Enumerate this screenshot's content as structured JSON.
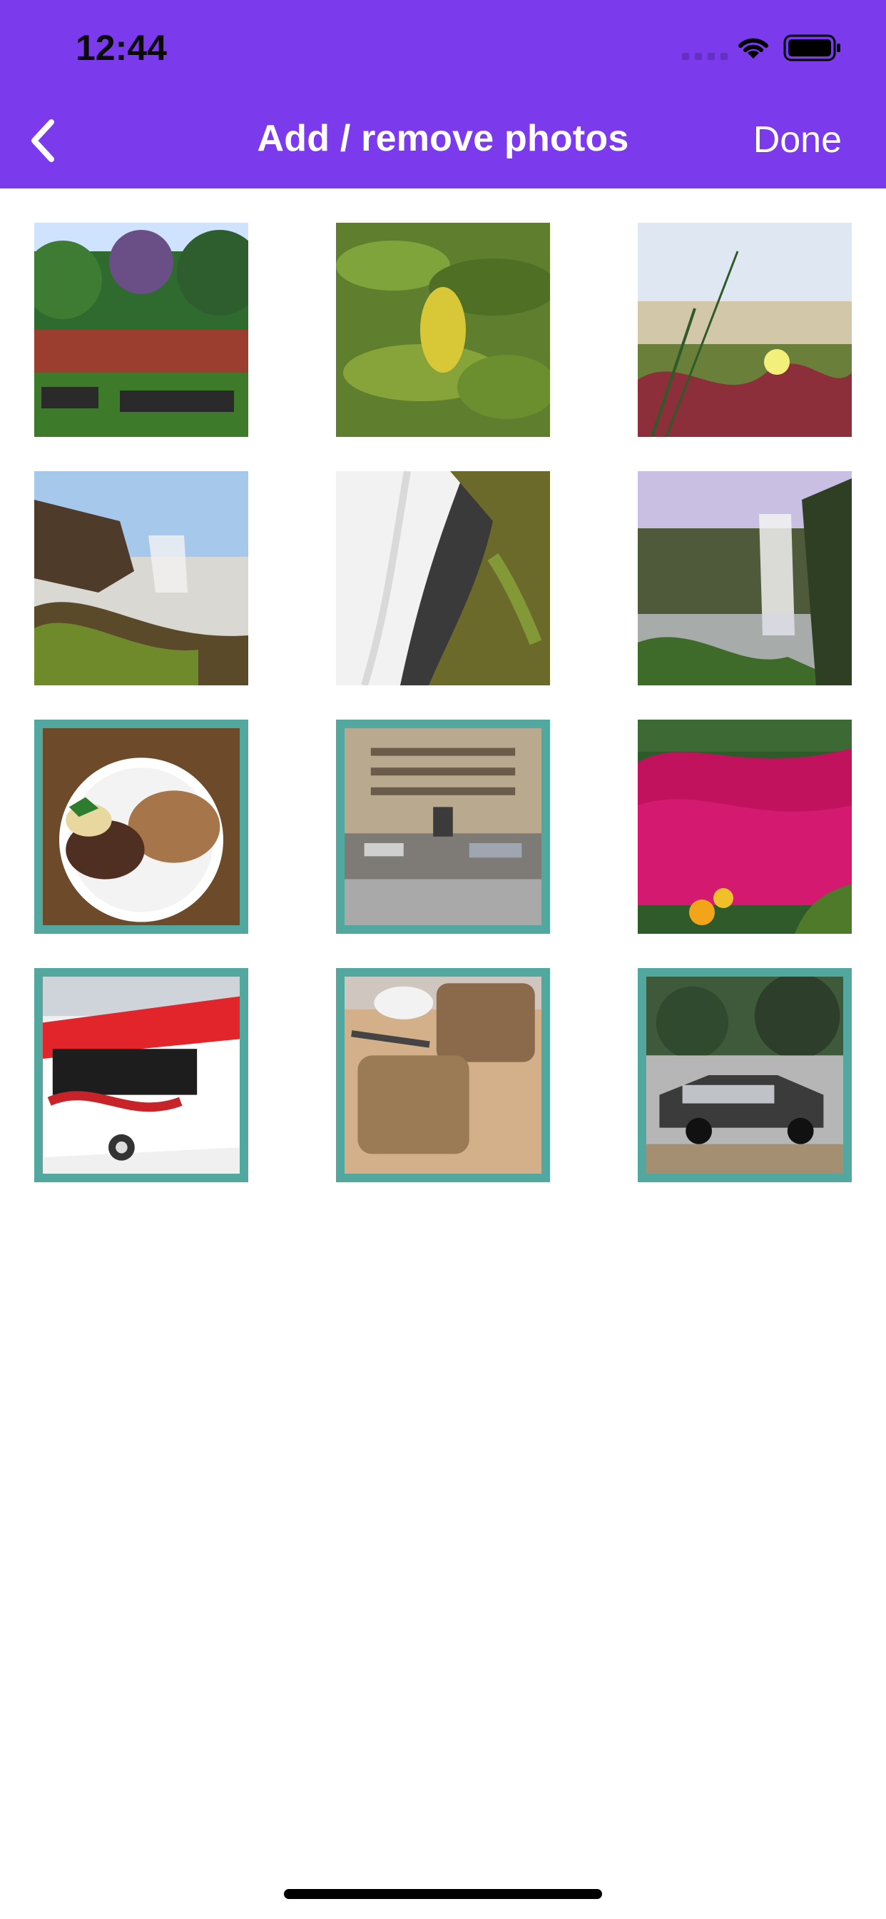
{
  "status_bar": {
    "time": "12:44"
  },
  "nav": {
    "title": "Add / remove photos",
    "done_label": "Done"
  },
  "colors": {
    "header": "#7c3aed",
    "selected_border": "#52a89f"
  },
  "photos": [
    {
      "subject": "garden with benches",
      "selected": false
    },
    {
      "subject": "green leaves",
      "selected": false
    },
    {
      "subject": "flower on dunes",
      "selected": false
    },
    {
      "subject": "waterfall by rocks",
      "selected": false
    },
    {
      "subject": "waterfall long exposure",
      "selected": false
    },
    {
      "subject": "misty waterfall",
      "selected": false
    },
    {
      "subject": "plate of food",
      "selected": true
    },
    {
      "subject": "building facade",
      "selected": true
    },
    {
      "subject": "pink flowers",
      "selected": false
    },
    {
      "subject": "red bus",
      "selected": true
    },
    {
      "subject": "bread loaf slices",
      "selected": true
    },
    {
      "subject": "vintage car",
      "selected": true
    }
  ]
}
